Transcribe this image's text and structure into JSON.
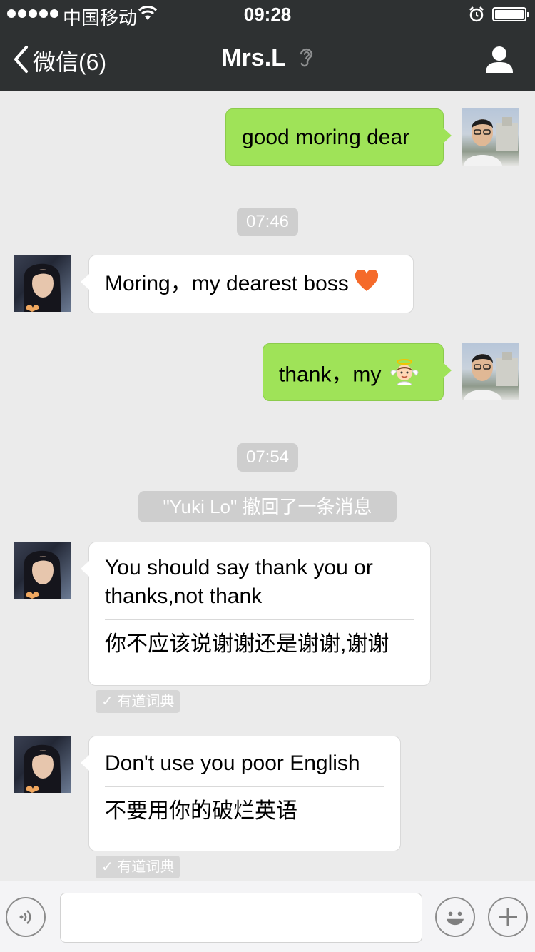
{
  "status_bar": {
    "carrier": "中国移动",
    "time": "09:28",
    "battery_level": 1.0
  },
  "nav": {
    "back_label": "微信(6)",
    "title": "Mrs.L"
  },
  "messages": {
    "m1": {
      "from": "me",
      "text": "good moring dear"
    },
    "t1": "07:46",
    "m2": {
      "from": "her",
      "text": "Moring，my dearest boss",
      "emoji": "orange-heart"
    },
    "m3": {
      "from": "me",
      "text": "thank，my",
      "emoji": "angel"
    },
    "t2": "07:54",
    "recall": "\"Yuki Lo\" 撤回了一条消息",
    "m4": {
      "from": "her",
      "text": "You should say thank you or thanks,not thank",
      "translation": "你不应该说谢谢还是谢谢,谢谢",
      "tag": "有道词典"
    },
    "m5": {
      "from": "her",
      "text": "Don't use you poor English",
      "translation": "不要用你的破烂英语",
      "tag": "有道词典"
    }
  },
  "icons": {
    "back": "chevron-left-icon",
    "ear": "ear-icon",
    "profile": "person-icon",
    "voice": "voice-icon",
    "emoji": "smiley-icon",
    "plus": "plus-icon"
  },
  "colors": {
    "bar": "#2e3132",
    "bubble_me": "#9fe358",
    "bubble_her": "#ffffff",
    "background": "#ebebeb"
  }
}
